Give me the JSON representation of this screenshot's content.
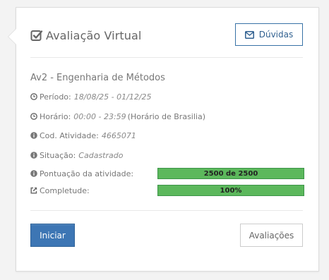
{
  "card": {
    "title": "Avaliação Virtual",
    "help_button_label": "Dúvidas",
    "activity_name": "Av2 - Engenharia de Métodos",
    "periodo": {
      "label": "Período:",
      "value": "18/08/25 - 01/12/25"
    },
    "horario": {
      "label": "Horário:",
      "value": "00:00 - 23:59",
      "extra": "(Horário de Brasilia)"
    },
    "codigo": {
      "label": "Cod. Atividade:",
      "value": "4665071"
    },
    "situacao": {
      "label": "Situação:",
      "value": "Cadastrado"
    },
    "pontuacao": {
      "label": "Pontuação da atividade:",
      "text": "2500 de 2500",
      "fraction": 1.0
    },
    "completude": {
      "label": "Completude:",
      "text": "100%",
      "fraction": 1.0
    },
    "start_button_label": "Iniciar",
    "evaluations_button_label": "Avaliações"
  },
  "colors": {
    "primary": "#3d76b4",
    "progress": "#5cb85c",
    "icon": "#666666"
  },
  "icons": {
    "title": "check-square-icon",
    "help": "envelope-icon",
    "periodo": "clock-icon",
    "horario": "clock-icon",
    "codigo": "info-circle-icon",
    "situacao": "info-circle-icon",
    "pontuacao": "info-circle-icon",
    "completude": "external-link-icon"
  }
}
